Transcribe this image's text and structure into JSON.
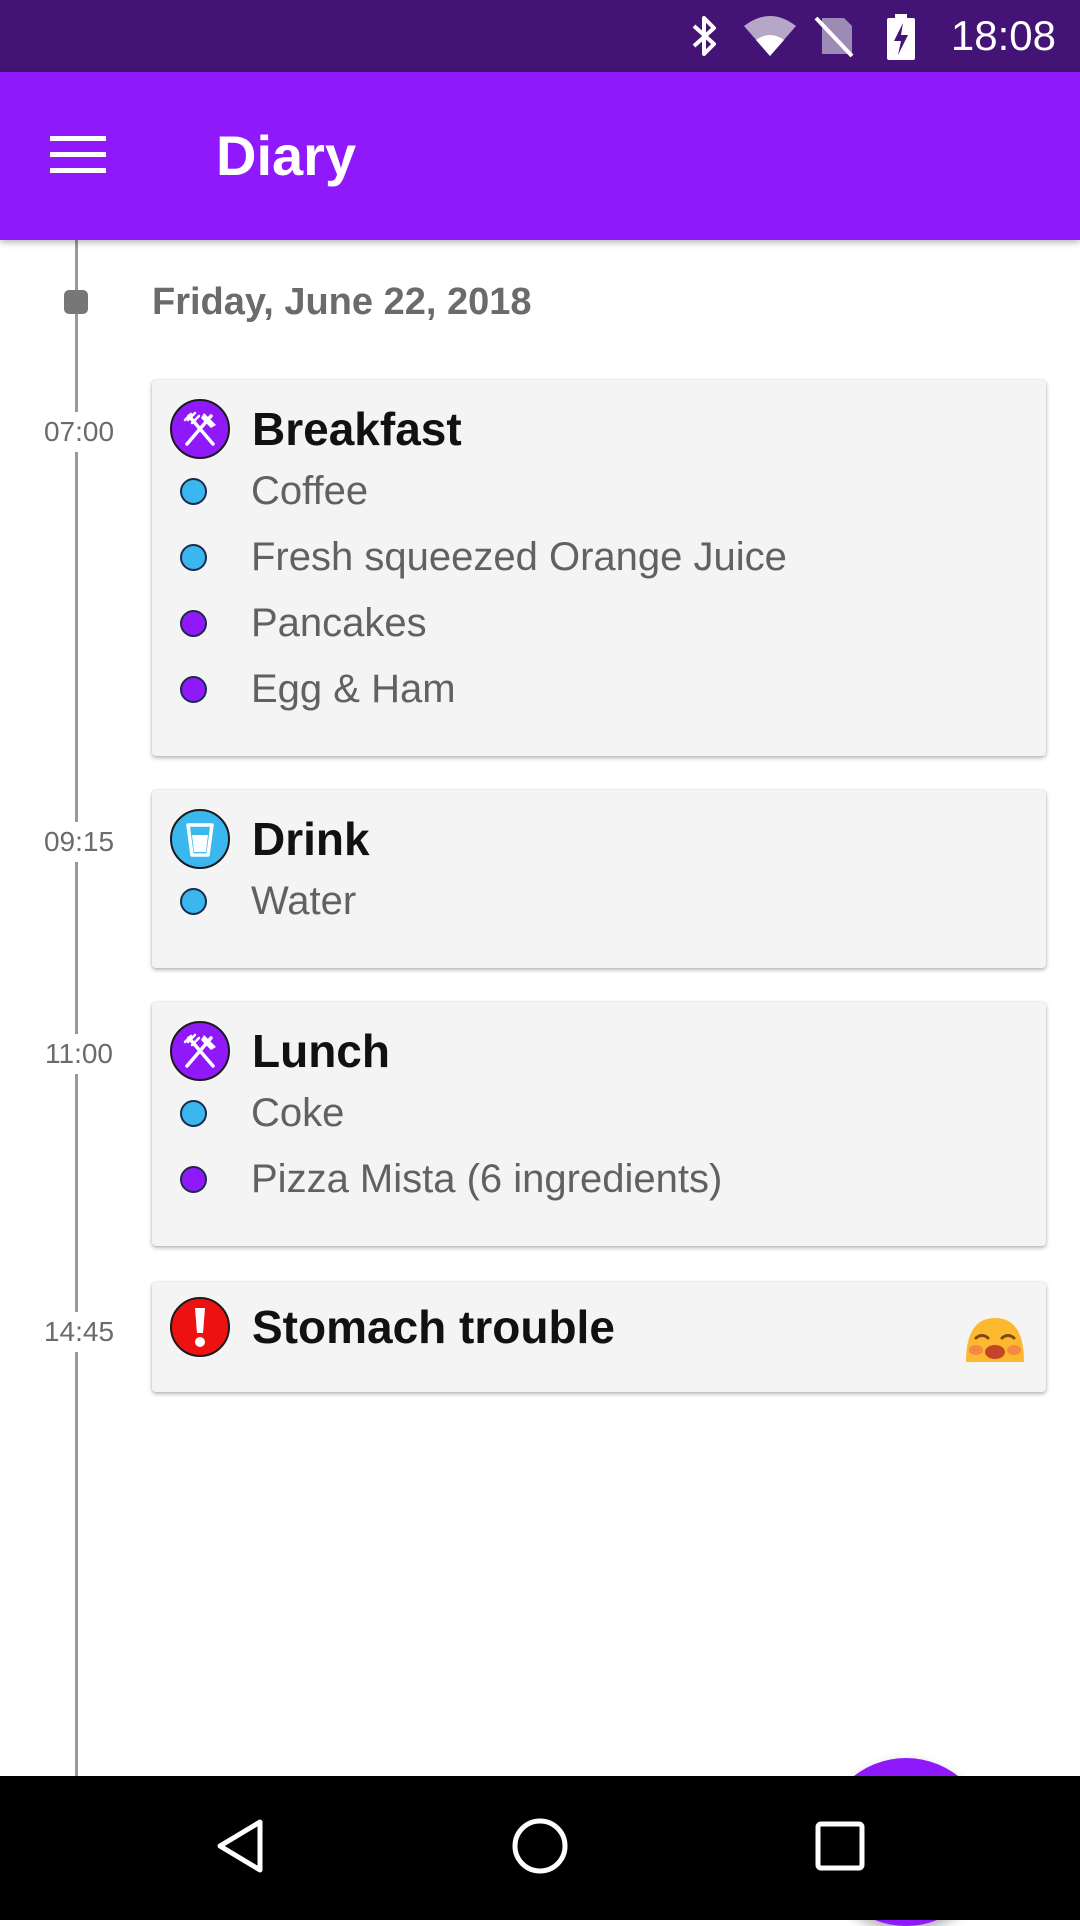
{
  "status_bar": {
    "time": "18:08",
    "background": "#431375",
    "icons": [
      "bluetooth-icon",
      "wifi-icon",
      "no-sim-icon",
      "battery-charging-icon"
    ]
  },
  "app_bar": {
    "title": "Diary",
    "menu_icon": "menu-icon",
    "background": "#9019fb"
  },
  "timeline": {
    "date": "Friday, June 22, 2018",
    "entries": [
      {
        "time": "07:00",
        "title": "Breakfast",
        "icon": "fork-knife-icon",
        "icon_color": "#9019fb",
        "items": [
          {
            "text": "Coffee",
            "bullet": "drink",
            "color": "#3bb7ef"
          },
          {
            "text": "Fresh squeezed Orange Juice",
            "bullet": "drink",
            "color": "#3bb7ef"
          },
          {
            "text": "Pancakes",
            "bullet": "food",
            "color": "#9019fb"
          },
          {
            "text": "Egg & Ham",
            "bullet": "food",
            "color": "#9019fb"
          }
        ]
      },
      {
        "time": "09:15",
        "title": "Drink",
        "icon": "glass-icon",
        "icon_color": "#3bb7ef",
        "items": [
          {
            "text": "Water",
            "bullet": "drink",
            "color": "#3bb7ef"
          }
        ]
      },
      {
        "time": "11:00",
        "title": "Lunch",
        "icon": "fork-knife-icon",
        "icon_color": "#9019fb",
        "items": [
          {
            "text": "Coke",
            "bullet": "drink",
            "color": "#3bb7ef"
          },
          {
            "text": "Pizza Mista (6 ingredients)",
            "bullet": "food",
            "color": "#9019fb"
          }
        ]
      },
      {
        "time": "14:45",
        "title": "Stomach trouble",
        "icon": "exclamation-icon",
        "icon_color": "#ee1111",
        "emoji": "sick-face-emoji-icon",
        "items": []
      }
    ]
  },
  "fab": {
    "icon": "plus-icon",
    "color": "#9019fb"
  },
  "nav_bar": {
    "icons": [
      "back-icon",
      "home-icon",
      "recents-icon"
    ]
  }
}
